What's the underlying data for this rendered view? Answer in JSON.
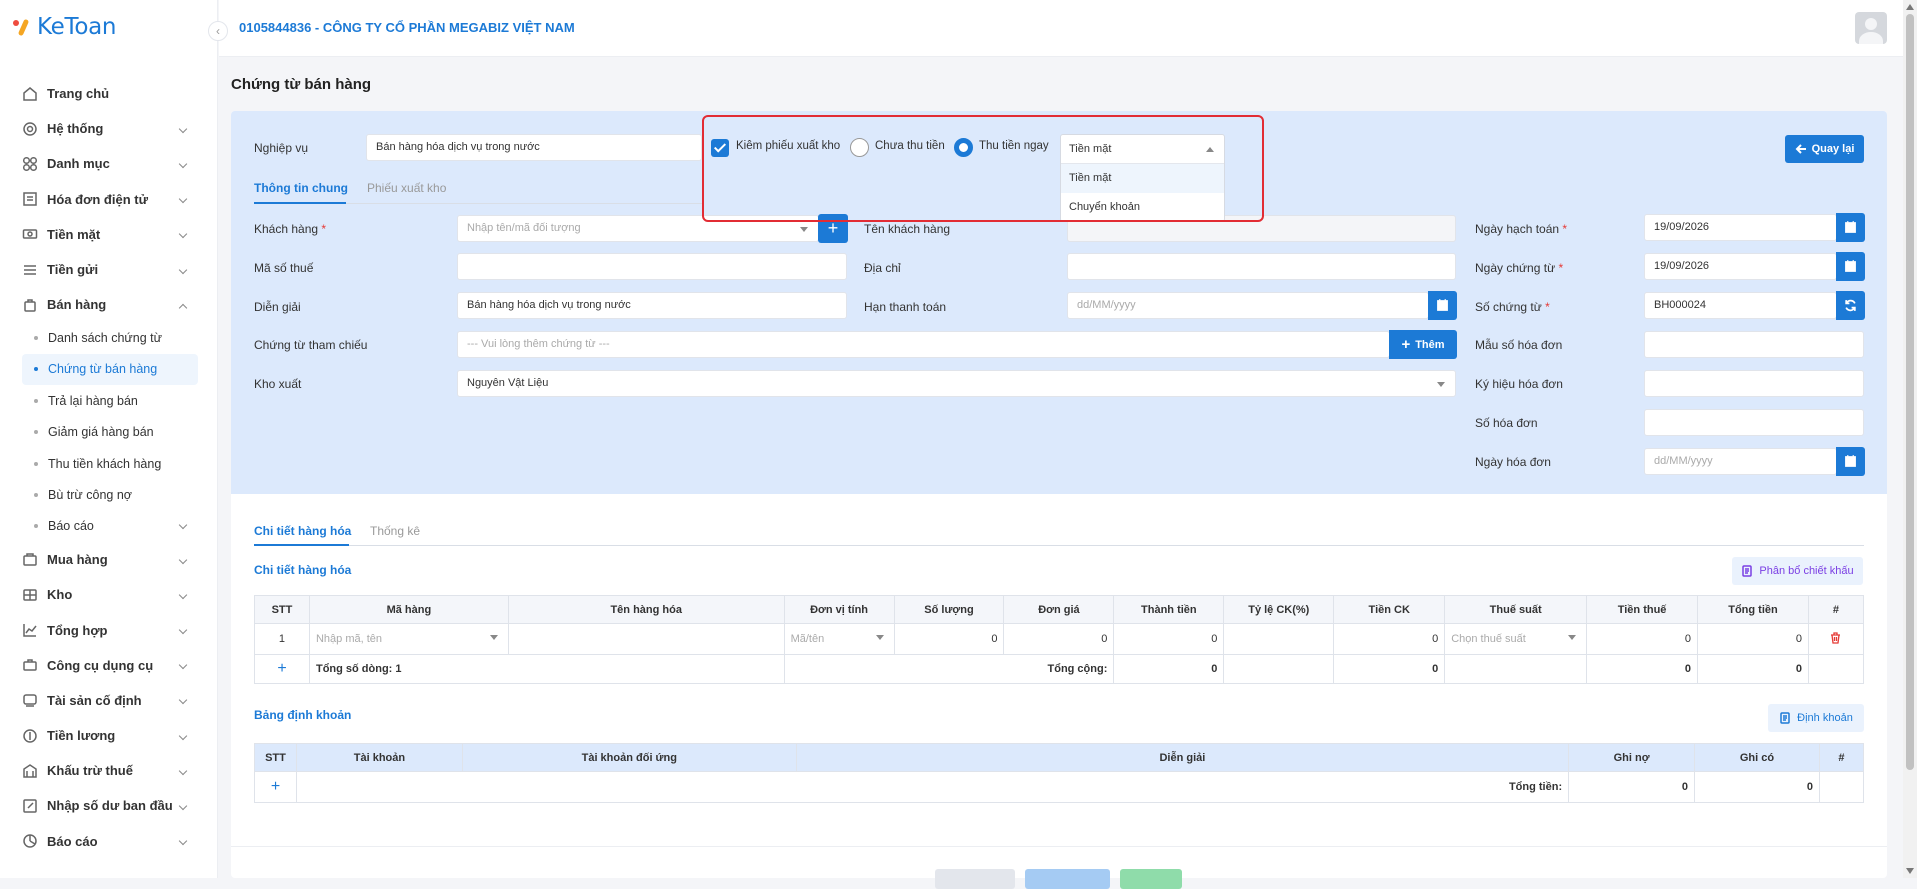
{
  "app": {
    "logo": "KeToan"
  },
  "topbar": {
    "company": "0105844836 - CÔNG TY CỔ PHẦN MEGABIZ VIỆT NAM"
  },
  "sidebar": {
    "items": [
      {
        "label": "Trang chủ",
        "icon": "home-icon"
      },
      {
        "label": "Hệ thống",
        "icon": "gear-icon"
      },
      {
        "label": "Danh mục",
        "icon": "grid-icon"
      },
      {
        "label": "Hóa đơn điện tử",
        "icon": "invoice-icon"
      },
      {
        "label": "Tiền mặt",
        "icon": "cash-icon"
      },
      {
        "label": "Tiền gửi",
        "icon": "bank-icon"
      },
      {
        "label": "Bán hàng",
        "icon": "bag-icon"
      },
      {
        "label": "Mua hàng",
        "icon": "cart-icon"
      },
      {
        "label": "Kho",
        "icon": "warehouse-icon"
      },
      {
        "label": "Tổng hợp",
        "icon": "chart-icon"
      },
      {
        "label": "Công cụ dụng cụ",
        "icon": "tools-icon"
      },
      {
        "label": "Tài sản cố định",
        "icon": "asset-icon"
      },
      {
        "label": "Tiền lương",
        "icon": "salary-icon"
      },
      {
        "label": "Khấu trừ thuế",
        "icon": "tax-icon"
      },
      {
        "label": "Nhập số dư ban đầu",
        "icon": "edit-icon"
      },
      {
        "label": "Báo cáo",
        "icon": "report-icon"
      }
    ],
    "sub": [
      {
        "label": "Danh sách chứng từ"
      },
      {
        "label": "Chứng từ bán hàng"
      },
      {
        "label": "Trả lại hàng bán"
      },
      {
        "label": "Giảm giá hàng bán"
      },
      {
        "label": "Thu tiền khách hàng"
      },
      {
        "label": "Bù trừ công nợ"
      },
      {
        "label": "Báo cáo"
      }
    ]
  },
  "page": {
    "title": "Chứng từ bán hàng",
    "back": "Quay lại"
  },
  "form": {
    "nghiep_vu_label": "Nghiệp vụ",
    "nghiep_vu_value": "Bán hàng hóa dịch vụ trong nước",
    "kiem_phieu": "Kiêm phiếu xuất kho",
    "chua_thu": "Chưa thu tiền",
    "thu_ngay": "Thu tiền ngay",
    "payment_selected": "Tiền mặt",
    "payment_options": [
      "Tiền mặt",
      "Chuyển khoản"
    ],
    "tabs": [
      "Thông tin chung",
      "Phiếu xuất kho"
    ],
    "khach_hang_label": "Khách hàng",
    "khach_hang_ph": "Nhập tên/mã đối tượng",
    "ten_kh_label": "Tên khách hàng",
    "mst_label": "Mã số thuế",
    "dia_chi_label": "Địa chỉ",
    "dien_giai_label": "Diễn giải",
    "dien_giai_value": "Bán hàng hóa dịch vụ trong nước",
    "han_tt_label": "Hạn thanh toán",
    "han_tt_ph": "dd/MM/yyyy",
    "ct_tham_chieu_label": "Chứng từ tham chiếu",
    "ct_tham_chieu_ph": "--- Vui lòng thêm chứng từ ---",
    "them": "Thêm",
    "kho_xuat_label": "Kho xuất",
    "kho_xuat_value": "Nguyên Vật Liệu",
    "ngay_hach_toan_label": "Ngày hạch toán",
    "ngay_hach_toan": "19/09/2026",
    "ngay_ct_label": "Ngày chứng từ",
    "ngay_ct": "19/09/2026",
    "so_ct_label": "Số chứng từ",
    "so_ct": "BH000024",
    "mau_so_label": "Mẫu số hóa đơn",
    "ky_hieu_label": "Ký hiệu hóa đơn",
    "so_hd_label": "Số hóa đơn",
    "ngay_hd_label": "Ngày hóa đơn",
    "ngay_hd_ph": "dd/MM/yyyy"
  },
  "detail": {
    "tabs": [
      "Chi tiết hàng hóa",
      "Thống kê"
    ],
    "section": "Chi tiết hàng hóa",
    "allocate_btn": "Phân bổ chiết khấu",
    "headers": [
      "STT",
      "Mã hàng",
      "Tên hàng hóa",
      "Đơn vị tính",
      "Số lượng",
      "Đơn giá",
      "Thành tiền",
      "Tỷ lệ CK(%)",
      "Tiền CK",
      "Thuế suất",
      "Tiền thuế",
      "Tổng tiền",
      "#"
    ],
    "row": {
      "stt": "1",
      "ma_ph": "Nhập mã, tên",
      "dvt_ph": "Mã/tên",
      "so_luong": "0",
      "don_gia": "0",
      "thanh_tien": "0",
      "tien_ck": "0",
      "thue_ph": "Chọn thuế suất",
      "tien_thue": "0",
      "tong_tien": "0"
    },
    "footer": {
      "plus": "+",
      "count": "Tổng số dòng: 1",
      "total_label": "Tổng cộng:",
      "thanh_tien": "0",
      "tien_ck": "0",
      "tien_thue": "0",
      "tong_tien": "0"
    }
  },
  "accounting": {
    "section": "Bảng định khoản",
    "btn": "Định khoản",
    "headers": [
      "STT",
      "Tài khoản",
      "Tài khoản đối ứng",
      "Diễn giải",
      "Ghi nợ",
      "Ghi có",
      "#"
    ],
    "footer": {
      "plus": "+",
      "total_label": "Tổng tiền:",
      "ghi_no": "0",
      "ghi_co": "0"
    }
  },
  "colors": {
    "accent": "#1c7ad6",
    "highlight": "#e22c34",
    "panel": "#dce9fc"
  }
}
